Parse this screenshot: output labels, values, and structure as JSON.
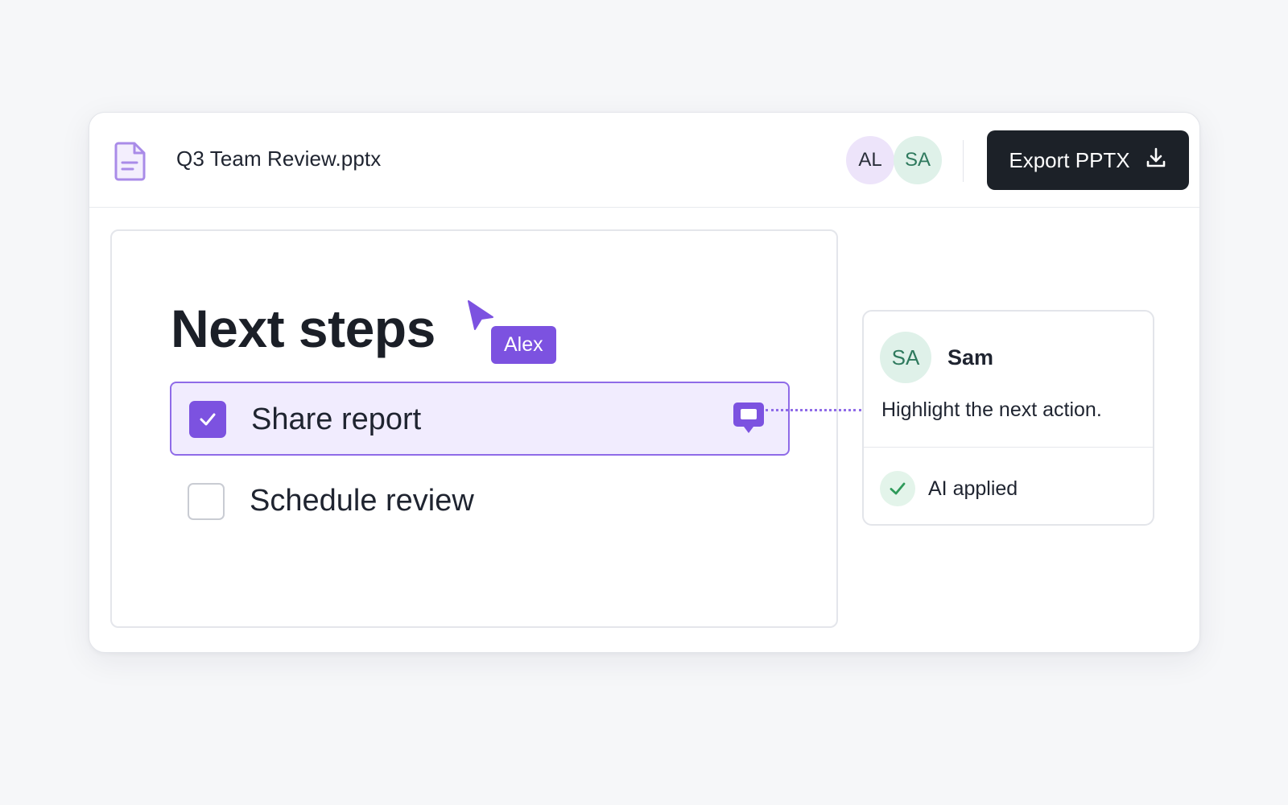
{
  "document": {
    "file_name": "Q3 Team Review.pptx",
    "file_icon": "document-icon"
  },
  "collaborators": [
    {
      "initials": "AL",
      "color": "#ede4fa"
    },
    {
      "initials": "SA",
      "color": "#dff1e9"
    }
  ],
  "toolbar": {
    "export_label": "Export PPTX",
    "export_icon": "download-icon"
  },
  "slide": {
    "title": "Next steps",
    "cursor": {
      "user": "Alex",
      "icon": "cursor-arrow-icon",
      "color": "#7c52e0"
    },
    "items": [
      {
        "label": "Share report",
        "checked": true,
        "highlighted": true,
        "has_comment": true
      },
      {
        "label": "Schedule review",
        "checked": false
      }
    ]
  },
  "comment": {
    "author_initials": "SA",
    "author_name": "Sam",
    "text": "Highlight the next action.",
    "status": "AI applied",
    "status_icon": "check-icon"
  },
  "colors": {
    "accent": "#7c52e0",
    "highlight_bg": "#f1ecfe",
    "button_dark": "#1c2128",
    "success": "#2e9a5a"
  }
}
